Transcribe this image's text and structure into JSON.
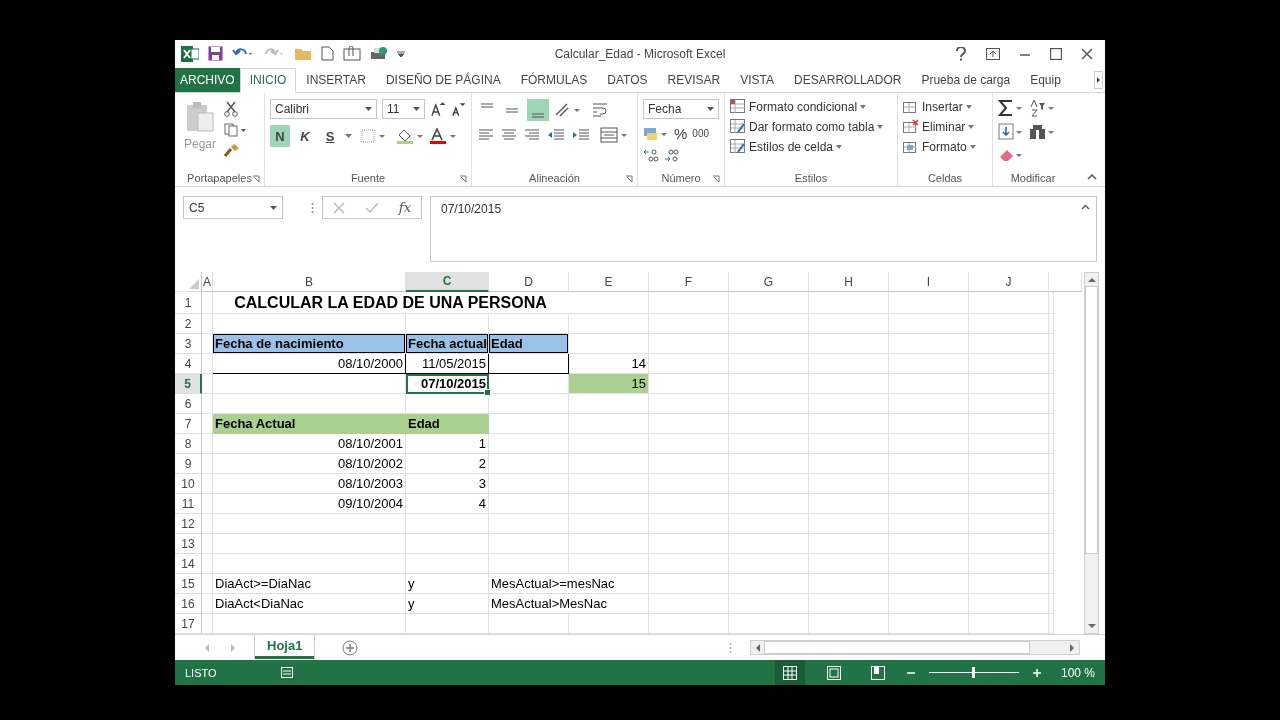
{
  "window": {
    "title": "Calcular_Edad - Microsoft Excel"
  },
  "tabs": [
    {
      "label": "ARCHIVO",
      "kind": "file",
      "selected": false
    },
    {
      "label": "INICIO",
      "kind": "tab",
      "selected": true
    },
    {
      "label": "INSERTAR",
      "kind": "tab",
      "selected": false
    },
    {
      "label": "DISEÑO DE PÁGINA",
      "kind": "tab",
      "selected": false
    },
    {
      "label": "FÓRMULAS",
      "kind": "tab",
      "selected": false
    },
    {
      "label": "DATOS",
      "kind": "tab",
      "selected": false
    },
    {
      "label": "REVISAR",
      "kind": "tab",
      "selected": false
    },
    {
      "label": "VISTA",
      "kind": "tab",
      "selected": false
    },
    {
      "label": "DESARROLLADOR",
      "kind": "tab",
      "selected": false
    },
    {
      "label": "Prueba de carga",
      "kind": "tab",
      "selected": false
    },
    {
      "label": "Equip",
      "kind": "tab",
      "selected": false
    }
  ],
  "ribbon": {
    "clipboard": {
      "paste": "Pegar",
      "label": "Portapapeles"
    },
    "font": {
      "name": "Calibri",
      "size": "11",
      "bold": {
        "label": "N",
        "on": true
      },
      "italic": {
        "label": "K",
        "on": false
      },
      "underline": {
        "label": "S",
        "on": false
      },
      "label": "Fuente"
    },
    "alignment": {
      "bottom_align_on": true,
      "label": "Alineación"
    },
    "number": {
      "format": "Fecha",
      "percent": "%",
      "thousands": "000",
      "label": "Número"
    },
    "styles": {
      "items": [
        "Formato condicional",
        "Dar formato como tabla",
        "Estilos de celda"
      ],
      "label": "Estilos"
    },
    "cells": {
      "items": [
        "Insertar",
        "Eliminar",
        "Formato"
      ],
      "label": "Celdas"
    },
    "editing": {
      "label": "Modificar"
    }
  },
  "formula_bar": {
    "name_box": "C5",
    "function_label": "fx",
    "value": "07/10/2015"
  },
  "sheet": {
    "columns": [
      {
        "label": "A",
        "selected": false
      },
      {
        "label": "B",
        "selected": false
      },
      {
        "label": "C",
        "selected": true
      },
      {
        "label": "D",
        "selected": false
      },
      {
        "label": "E",
        "selected": false
      },
      {
        "label": "F",
        "selected": false
      },
      {
        "label": "G",
        "selected": false
      },
      {
        "label": "H",
        "selected": false
      },
      {
        "label": "I",
        "selected": false
      },
      {
        "label": "J",
        "selected": false
      }
    ],
    "rows": [
      {
        "number": "1",
        "selected": false,
        "cells": [
          null,
          {
            "text": "CALCULAR LA EDAD DE UNA PERSONA",
            "kind": "title",
            "selected": false
          },
          null,
          null,
          null,
          null,
          null,
          null,
          null,
          null
        ]
      },
      {
        "number": "2",
        "selected": false,
        "cells": [
          null,
          null,
          null,
          null,
          null,
          null,
          null,
          null,
          null,
          null
        ]
      },
      {
        "number": "3",
        "selected": false,
        "cells": [
          null,
          {
            "text": "Fecha de nacimiento",
            "kind": "head-blue",
            "selected": false
          },
          {
            "text": "Fecha actual",
            "kind": "head-blue",
            "selected": false
          },
          {
            "text": "Edad",
            "kind": "head-blue",
            "selected": false
          },
          null,
          null,
          null,
          null,
          null,
          null
        ]
      },
      {
        "number": "4",
        "selected": false,
        "cells": [
          null,
          {
            "text": "08/10/2000",
            "kind": "boxed",
            "selected": false
          },
          {
            "text": "11/05/2015",
            "kind": "boxed",
            "selected": false
          },
          {
            "kind": "boxed",
            "selected": false
          },
          {
            "text": "14",
            "kind": "number",
            "selected": false
          },
          null,
          null,
          null,
          null,
          null
        ]
      },
      {
        "number": "5",
        "selected": true,
        "cells": [
          null,
          null,
          {
            "text": "07/10/2015",
            "kind": "bold-number",
            "selected": true
          },
          null,
          {
            "text": "15",
            "kind": "green-number",
            "selected": false
          },
          null,
          null,
          null,
          null,
          null
        ]
      },
      {
        "number": "6",
        "selected": false,
        "cells": [
          null,
          null,
          null,
          null,
          null,
          null,
          null,
          null,
          null,
          null
        ]
      },
      {
        "number": "7",
        "selected": false,
        "cells": [
          null,
          {
            "text": "Fecha Actual",
            "kind": "head-green",
            "selected": false
          },
          {
            "text": "Edad",
            "kind": "head-green",
            "selected": false
          },
          null,
          null,
          null,
          null,
          null,
          null,
          null
        ]
      },
      {
        "number": "8",
        "selected": false,
        "cells": [
          null,
          {
            "text": "08/10/2001",
            "kind": "number",
            "selected": false
          },
          {
            "text": "1",
            "kind": "number",
            "selected": false
          },
          null,
          null,
          null,
          null,
          null,
          null,
          null
        ]
      },
      {
        "number": "9",
        "selected": false,
        "cells": [
          null,
          {
            "text": "08/10/2002",
            "kind": "number",
            "selected": false
          },
          {
            "text": "2",
            "kind": "number",
            "selected": false
          },
          null,
          null,
          null,
          null,
          null,
          null,
          null
        ]
      },
      {
        "number": "10",
        "selected": false,
        "cells": [
          null,
          {
            "text": "08/10/2003",
            "kind": "number",
            "selected": false
          },
          {
            "text": "3",
            "kind": "number",
            "selected": false
          },
          null,
          null,
          null,
          null,
          null,
          null,
          null
        ]
      },
      {
        "number": "11",
        "selected": false,
        "cells": [
          null,
          {
            "text": "09/10/2004",
            "kind": "number",
            "selected": false
          },
          {
            "text": "4",
            "kind": "number",
            "selected": false
          },
          null,
          null,
          null,
          null,
          null,
          null,
          null
        ]
      },
      {
        "number": "12",
        "selected": false,
        "cells": [
          null,
          null,
          null,
          null,
          null,
          null,
          null,
          null,
          null,
          null
        ]
      },
      {
        "number": "13",
        "selected": false,
        "cells": [
          null,
          null,
          null,
          null,
          null,
          null,
          null,
          null,
          null,
          null
        ]
      },
      {
        "number": "14",
        "selected": false,
        "cells": [
          null,
          null,
          null,
          null,
          null,
          null,
          null,
          null,
          null,
          null
        ]
      },
      {
        "number": "15",
        "selected": false,
        "cells": [
          null,
          {
            "text": "DiaAct>=DiaNac",
            "kind": "text",
            "selected": false
          },
          {
            "text": "y",
            "kind": "text",
            "selected": false
          },
          {
            "text": "MesActual>=mesNac",
            "kind": "note",
            "selected": false
          },
          null,
          null,
          null,
          null,
          null,
          null
        ]
      },
      {
        "number": "16",
        "selected": false,
        "cells": [
          null,
          {
            "text": "DiaAct<DiaNac",
            "kind": "text",
            "selected": false
          },
          {
            "text": "y",
            "kind": "text",
            "selected": false
          },
          {
            "text": "MesActual>MesNac",
            "kind": "note",
            "selected": false
          },
          null,
          null,
          null,
          null,
          null,
          null
        ]
      },
      {
        "number": "17",
        "selected": false,
        "cells": [
          null,
          null,
          null,
          null,
          null,
          null,
          null,
          null,
          null,
          null
        ]
      }
    ]
  },
  "sheet_tabs": [
    {
      "label": "Hoja1",
      "selected": true
    }
  ],
  "status_bar": {
    "mode": "LISTO",
    "zoom_text": "100 %",
    "zoom": {
      "level": 0.5
    }
  }
}
